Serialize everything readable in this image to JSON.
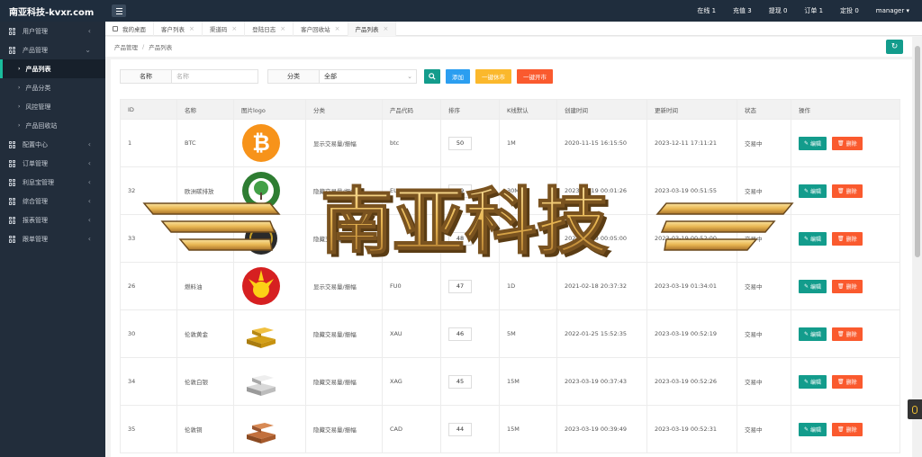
{
  "brand": "南亚科技-kvxr.com",
  "top_stats": [
    "在线 1",
    "充值 3",
    "提现 0",
    "订单 1",
    "定投 0"
  ],
  "user": "manager",
  "sidebar": {
    "items": [
      {
        "label": "用户管理",
        "chevron": "‹"
      },
      {
        "label": "产品管理",
        "chevron": "⌄"
      }
    ],
    "sub": [
      {
        "label": "产品列表",
        "active": true
      },
      {
        "label": "产品分类",
        "active": false
      },
      {
        "label": "风控管理",
        "active": false
      },
      {
        "label": "产品回收站",
        "active": false
      }
    ],
    "items_after": [
      {
        "label": "配置中心",
        "chevron": "‹"
      },
      {
        "label": "订单管理",
        "chevron": "‹"
      },
      {
        "label": "利息宝管理",
        "chevron": "‹"
      },
      {
        "label": "综合管理",
        "chevron": "‹"
      },
      {
        "label": "报表管理",
        "chevron": "‹"
      },
      {
        "label": "跟单管理",
        "chevron": "‹"
      }
    ]
  },
  "tabs": [
    {
      "label": "我的桌面",
      "closable": false,
      "home": true
    },
    {
      "label": "客户列表",
      "closable": true
    },
    {
      "label": "渠道码",
      "closable": true
    },
    {
      "label": "登陆日志",
      "closable": true
    },
    {
      "label": "客户回收站",
      "closable": true
    },
    {
      "label": "产品列表",
      "closable": true,
      "active": true
    }
  ],
  "breadcrumb": [
    "产品管理",
    "产品列表"
  ],
  "filters": {
    "name_label": "名称",
    "name_placeholder": "名称",
    "category_label": "分类",
    "category_value": "全部",
    "add_label": "添加",
    "close_all_label": "一键休市",
    "open_all_label": "一键开市"
  },
  "table": {
    "headers": [
      "ID",
      "名称",
      "图片logo",
      "分类",
      "产品代码",
      "排序",
      "K线默认",
      "创建时间",
      "更新时间",
      "状态",
      "操作"
    ],
    "edit_label": "编辑",
    "delete_label": "删除",
    "rows": [
      {
        "id": "1",
        "name": "BTC",
        "logo": "bitcoin-logo",
        "category": "显示交易量/振幅",
        "code": "btc",
        "sort": "50",
        "kline": "1M",
        "created": "2020-11-15 16:15:50",
        "updated": "2023-12-11 17:11:21",
        "status": "交易中"
      },
      {
        "id": "32",
        "name": "欧洲碳排放",
        "logo": "carbon-neutral-logo",
        "category": "隐藏交易量/振幅",
        "code": "EUA",
        "sort": "49",
        "kline": "30M",
        "created": "2023-03-19 00:01:26",
        "updated": "2023-03-19 00:51:55",
        "status": "交易中"
      },
      {
        "id": "33",
        "name": "",
        "logo": "dark-coin-logo",
        "category": "隐藏交易量/振幅",
        "code": "",
        "sort": "48",
        "kline": "",
        "created": "2023-03-19 00:05:00",
        "updated": "2023-03-19 00:52:00",
        "status": "交易中"
      },
      {
        "id": "26",
        "name": "燃料油",
        "logo": "petrochina-logo",
        "category": "显示交易量/振幅",
        "code": "FU0",
        "sort": "47",
        "kline": "1D",
        "created": "2021-02-18 20:37:32",
        "updated": "2023-03-19 01:34:01",
        "status": "交易中"
      },
      {
        "id": "30",
        "name": "伦敦黄金",
        "logo": "gold-bars-image",
        "category": "隐藏交易量/振幅",
        "code": "XAU",
        "sort": "46",
        "kline": "5M",
        "created": "2022-01-25 15:52:35",
        "updated": "2023-03-19 00:52:19",
        "status": "交易中"
      },
      {
        "id": "34",
        "name": "伦敦白银",
        "logo": "silver-bars-image",
        "category": "隐藏交易量/振幅",
        "code": "XAG",
        "sort": "45",
        "kline": "15M",
        "created": "2023-03-19 00:37:43",
        "updated": "2023-03-19 00:52:26",
        "status": "交易中"
      },
      {
        "id": "35",
        "name": "伦敦铜",
        "logo": "copper-bars-image",
        "category": "隐藏交易量/振幅",
        "code": "CAD",
        "sort": "44",
        "kline": "15M",
        "created": "2023-03-19 00:39:49",
        "updated": "2023-03-19 00:52:31",
        "status": "交易中"
      }
    ]
  },
  "watermark": "南亚科技",
  "colors": {
    "topbar": "#1f2d3d",
    "sidebar": "#222d3b",
    "teal": "#139c8c",
    "blue": "#2b9ef0",
    "yellow": "#fbb82c",
    "orange_red": "#fa5a2e",
    "watermark_gold": "#e8b652"
  }
}
